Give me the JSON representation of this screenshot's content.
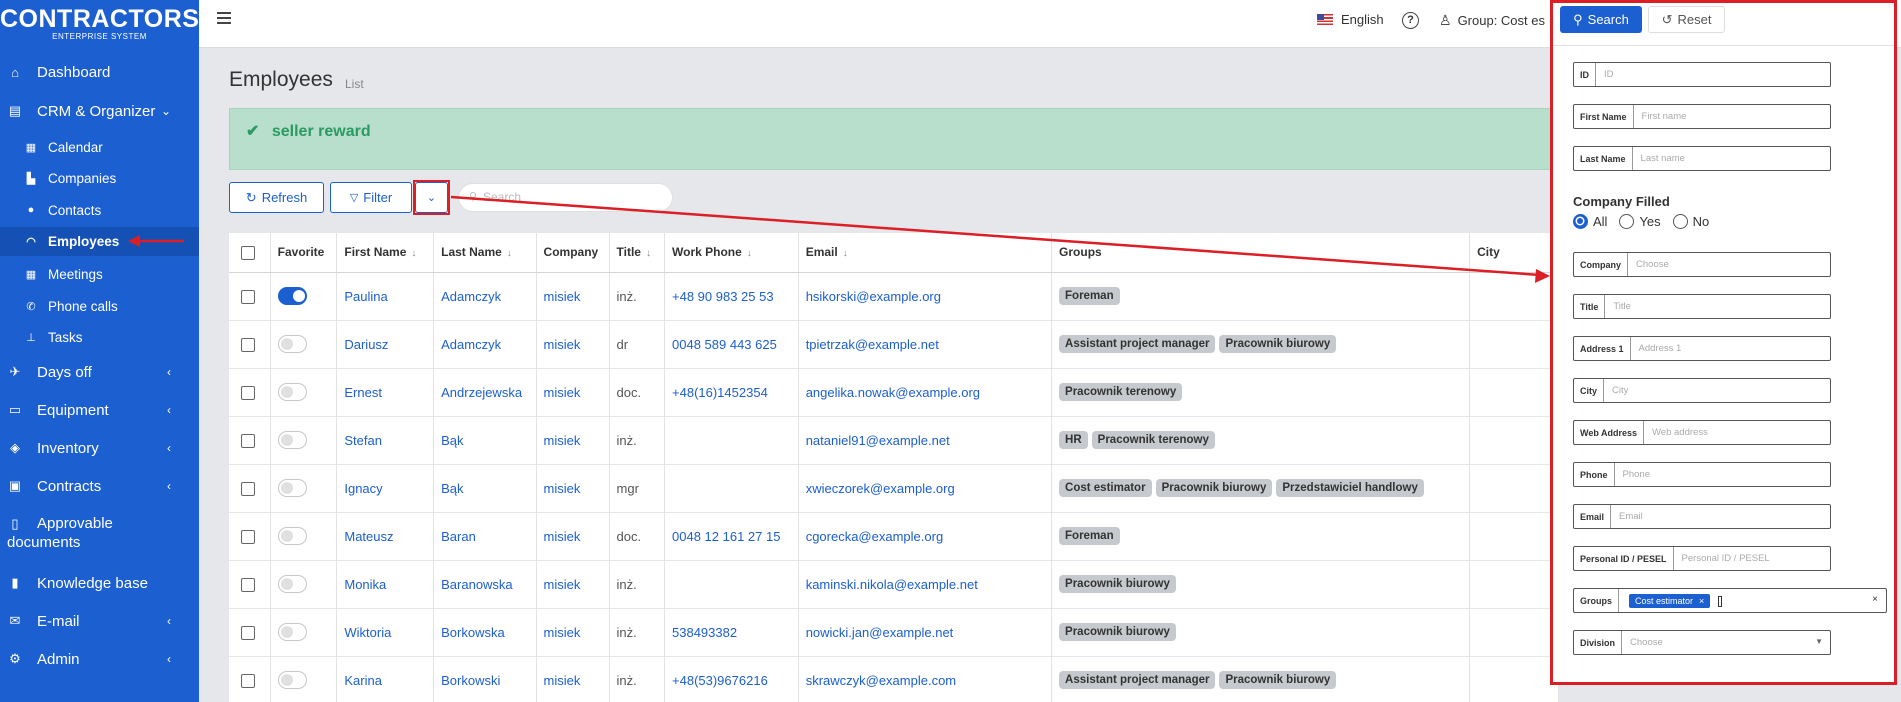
{
  "app": {
    "logo_main": "CONTRACTORS",
    "logo_sub": "ENTERPRISE SYSTEM"
  },
  "sidebar": {
    "items": [
      {
        "label": "Dashboard",
        "icon": "home-icon"
      },
      {
        "label": "CRM & Organizer",
        "icon": "id-card-icon"
      },
      {
        "label": "Calendar",
        "icon": "calendar-icon"
      },
      {
        "label": "Companies",
        "icon": "industry-icon"
      },
      {
        "label": "Contacts",
        "icon": "user-icon"
      },
      {
        "label": "Employees",
        "icon": "helmet-icon"
      },
      {
        "label": "Meetings",
        "icon": "calendar-check-icon"
      },
      {
        "label": "Phone calls",
        "icon": "phone-icon"
      },
      {
        "label": "Tasks",
        "icon": "pin-icon"
      },
      {
        "label": "Days off",
        "icon": "plane-icon"
      },
      {
        "label": "Equipment",
        "icon": "toolbox-icon"
      },
      {
        "label": "Inventory",
        "icon": "cubes-icon"
      },
      {
        "label": "Contracts",
        "icon": "briefcase-icon"
      },
      {
        "label": "Approvable",
        "label2": "documents",
        "icon": "document-icon"
      },
      {
        "label": "Knowledge base",
        "icon": "book-icon"
      },
      {
        "label": "E-mail",
        "icon": "envelope-icon"
      },
      {
        "label": "Admin",
        "icon": "cogs-icon"
      }
    ]
  },
  "topbar": {
    "language": "English",
    "group": "Group: Cost es"
  },
  "page": {
    "title": "Employees",
    "subtitle": "List"
  },
  "alert": {
    "text": "seller reward"
  },
  "toolbar": {
    "refresh_label": "Refresh",
    "filter_label": "Filter",
    "search_placeholder": "Search"
  },
  "table": {
    "headers": {
      "favorite": "Favorite",
      "first_name": "First Name",
      "last_name": "Last Name",
      "company": "Company",
      "title": "Title",
      "work_phone": "Work Phone",
      "email": "Email",
      "groups": "Groups",
      "city": "City"
    },
    "rows": [
      {
        "favorite": true,
        "first_name": "Paulina",
        "last_name": "Adamczyk",
        "company": "misiek",
        "title": "inż.",
        "work_phone": "+48 90 983 25 53",
        "email": "hsikorski@example.org",
        "groups": [
          "Foreman"
        ]
      },
      {
        "favorite": false,
        "first_name": "Dariusz",
        "last_name": "Adamczyk",
        "company": "misiek",
        "title": "dr",
        "work_phone": "0048 589 443 625",
        "email": "tpietrzak@example.net",
        "groups": [
          "Assistant project manager",
          "Pracownik biurowy"
        ]
      },
      {
        "favorite": false,
        "first_name": "Ernest",
        "last_name": "Andrzejewska",
        "company": "misiek",
        "title": "doc.",
        "work_phone": "+48(16)1452354",
        "email": "angelika.nowak@example.org",
        "groups": [
          "Pracownik terenowy"
        ]
      },
      {
        "favorite": false,
        "first_name": "Stefan",
        "last_name": "Bąk",
        "company": "misiek",
        "title": "inż.",
        "work_phone": "",
        "email": "nataniel91@example.net",
        "groups": [
          "HR",
          "Pracownik terenowy"
        ]
      },
      {
        "favorite": false,
        "first_name": "Ignacy",
        "last_name": "Bąk",
        "company": "misiek",
        "title": "mgr",
        "work_phone": "",
        "email": "xwieczorek@example.org",
        "groups": [
          "Cost estimator",
          "Pracownik biurowy",
          "Przedstawiciel handlowy"
        ]
      },
      {
        "favorite": false,
        "first_name": "Mateusz",
        "last_name": "Baran",
        "company": "misiek",
        "title": "doc.",
        "work_phone": "0048 12 161 27 15",
        "email": "cgorecka@example.org",
        "groups": [
          "Foreman"
        ]
      },
      {
        "favorite": false,
        "first_name": "Monika",
        "last_name": "Baranowska",
        "company": "misiek",
        "title": "inż.",
        "work_phone": "",
        "email": "kaminski.nikola@example.net",
        "groups": [
          "Pracownik biurowy"
        ]
      },
      {
        "favorite": false,
        "first_name": "Wiktoria",
        "last_name": "Borkowska",
        "company": "misiek",
        "title": "inż.",
        "work_phone": "538493382",
        "email": "nowicki.jan@example.net",
        "groups": [
          "Pracownik biurowy"
        ]
      },
      {
        "favorite": false,
        "first_name": "Karina",
        "last_name": "Borkowski",
        "company": "misiek",
        "title": "inż.",
        "work_phone": "+48(53)9676216",
        "email": "skrawczyk@example.com",
        "groups": [
          "Assistant project manager",
          "Pracownik biurowy"
        ]
      }
    ]
  },
  "panel": {
    "search_label": "Search",
    "reset_label": "Reset",
    "fields": [
      {
        "label": "ID",
        "placeholder": "ID"
      },
      {
        "label": "First Name",
        "placeholder": "First name"
      },
      {
        "label": "Last Name",
        "placeholder": "Last name"
      }
    ],
    "company_filled": {
      "title": "Company Filled",
      "options": [
        "All",
        "Yes",
        "No"
      ],
      "selected": "All"
    },
    "fields2": [
      {
        "label": "Company",
        "placeholder": "Choose"
      },
      {
        "label": "Title",
        "placeholder": "Title"
      },
      {
        "label": "Address 1",
        "placeholder": "Address 1"
      },
      {
        "label": "City",
        "placeholder": "City"
      },
      {
        "label": "Web Address",
        "placeholder": "Web address"
      },
      {
        "label": "Phone",
        "placeholder": "Phone"
      },
      {
        "label": "Email",
        "placeholder": "Email"
      },
      {
        "label": "Personal ID / PESEL",
        "placeholder": "Personal ID / PESEL"
      }
    ],
    "groups": {
      "label": "Groups",
      "selected": "Cost estimator"
    },
    "division": {
      "label": "Division",
      "placeholder": "Choose"
    }
  },
  "colors": {
    "sidebar": "#1b5fd0",
    "accent": "#1b5fd0",
    "annotation_red": "#dc1e26",
    "alert_bg": "#b7dfcb",
    "alert_text": "#2b9a63"
  }
}
